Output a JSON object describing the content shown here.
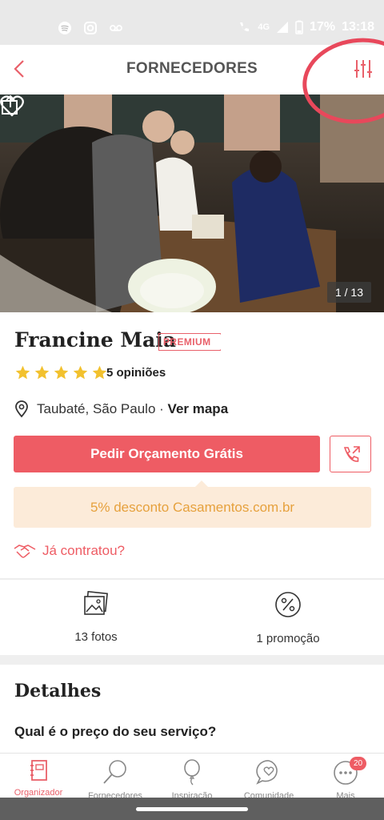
{
  "status_bar": {
    "network": "4G",
    "battery": "17%",
    "time": "13:18",
    "icons": [
      "spotify-icon",
      "instagram-icon",
      "voicemail-icon",
      "wifi-call-icon",
      "signal-icon",
      "battery-icon"
    ]
  },
  "header": {
    "title": "FORNECEDORES"
  },
  "gallery": {
    "counter": "1 / 13"
  },
  "vendor": {
    "name": "Francine Maia",
    "badge": "PREMIUM",
    "rating": 5,
    "reviews_label": "5 opiniões",
    "location": "Taubaté, São Paulo",
    "location_separator": "·",
    "map_link": "Ver mapa"
  },
  "actions": {
    "quote_button": "Pedir Orçamento Grátis",
    "promo_text": "5% desconto Casamentos.com.br",
    "contracted_link": "Já contratou?"
  },
  "stats": [
    {
      "label": "13 fotos",
      "icon": "photos-icon"
    },
    {
      "label": "1 promoção",
      "icon": "percent-icon"
    }
  ],
  "details": {
    "title": "Detalhes",
    "question": "Qual é o preço do seu serviço?"
  },
  "nav": {
    "items": [
      {
        "label": "Organizador",
        "icon": "notebook-icon"
      },
      {
        "label": "Fornecedores",
        "icon": "search-icon"
      },
      {
        "label": "Inspiração",
        "icon": "balloon-icon"
      },
      {
        "label": "Comunidade",
        "icon": "chat-heart-icon"
      },
      {
        "label": "Mais",
        "icon": "more-icon"
      }
    ],
    "badge_count": "20"
  },
  "colors": {
    "accent": "#ee5c64",
    "promo_bg": "#fcebd9",
    "promo_text": "#e6a13d",
    "star": "#f2c12e"
  }
}
